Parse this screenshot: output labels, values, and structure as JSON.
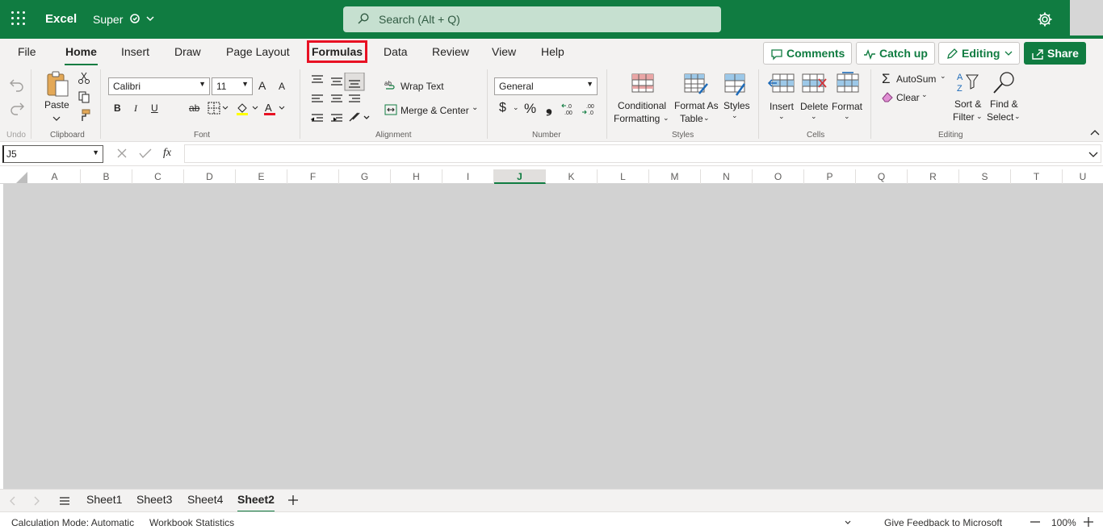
{
  "app": {
    "name": "Excel",
    "document": "Super"
  },
  "search": {
    "placeholder": "Search (Alt + Q)"
  },
  "tabs": [
    "File",
    "Home",
    "Insert",
    "Draw",
    "Page Layout",
    "Formulas",
    "Data",
    "Review",
    "View",
    "Help"
  ],
  "active_tab": "Home",
  "highlighted_tab": "Formulas",
  "actions": {
    "comments": "Comments",
    "catch_up": "Catch up",
    "editing": "Editing",
    "share": "Share"
  },
  "ribbon": {
    "undo_label": "Undo",
    "clipboard": {
      "paste": "Paste",
      "group": "Clipboard"
    },
    "font": {
      "name": "Calibri",
      "size": "11",
      "group": "Font",
      "bold": "B",
      "italic": "I",
      "underline": "U",
      "strike": "ab",
      "grow": "A",
      "shrink": "A"
    },
    "alignment": {
      "wrap": "Wrap Text",
      "merge": "Merge & Center",
      "group": "Alignment"
    },
    "number": {
      "format": "General",
      "currency": "$",
      "percent": "%",
      "comma": "❟",
      "group": "Number"
    },
    "styles": {
      "conditional_1": "Conditional",
      "conditional_2": "Formatting",
      "format_table_1": "Format As",
      "format_table_2": "Table",
      "styles": "Styles",
      "group": "Styles"
    },
    "cells": {
      "insert": "Insert",
      "delete": "Delete",
      "format": "Format",
      "group": "Cells"
    },
    "editing": {
      "autosum": "AutoSum",
      "clear": "Clear",
      "sort_1": "Sort &",
      "sort_2": "Filter",
      "find_1": "Find &",
      "find_2": "Select",
      "group": "Editing"
    }
  },
  "formula_bar": {
    "cell_ref": "J5",
    "fx": "fx"
  },
  "columns": [
    "A",
    "B",
    "C",
    "D",
    "E",
    "F",
    "G",
    "H",
    "I",
    "J",
    "K",
    "L",
    "M",
    "N",
    "O",
    "P",
    "Q",
    "R",
    "S",
    "T",
    "U"
  ],
  "selected_column": "J",
  "sheets": [
    "Sheet1",
    "Sheet3",
    "Sheet4",
    "Sheet2"
  ],
  "active_sheet": "Sheet2",
  "status": {
    "calc_mode": "Calculation Mode: Automatic",
    "workbook_stats": "Workbook Statistics",
    "feedback": "Give Feedback to Microsoft",
    "zoom": "100%"
  },
  "colors": {
    "brand": "#107c41",
    "highlight": "#e81123",
    "grid_bg": "#d2d2d2"
  }
}
